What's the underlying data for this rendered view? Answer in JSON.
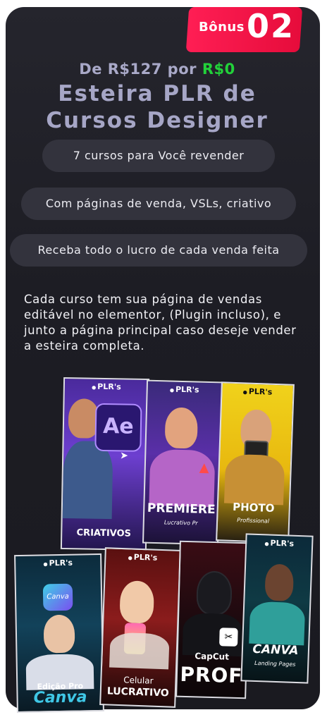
{
  "badge": {
    "label": "Bônus",
    "number": "02"
  },
  "price": {
    "from": "De R$127 por",
    "to": "R$0"
  },
  "title": {
    "line1": "Esteira PLR de",
    "line2": "Cursos Designer"
  },
  "pills": [
    "7 cursos para Você revender",
    "Com páginas de venda, VSLs, criativo",
    "Receba todo o lucro de cada venda feita"
  ],
  "description": "Cada curso tem sua página de vendas editável no elementor, (Plugin incluso), e junto a página principal caso deseje vender a esteira completa.",
  "covers": {
    "logo": "PLR's",
    "ae": {
      "icon": "Ae",
      "title": "CRIATIVOS"
    },
    "premiere": {
      "title": "PREMIERE",
      "sub": "Lucrativo Pr"
    },
    "photo": {
      "title": "PHOTO",
      "sub": "Profissional"
    },
    "canva_pro": {
      "icon": "Canva",
      "title": "Edição Pro",
      "brand": "Canva"
    },
    "celular": {
      "title": "Celular",
      "sub": "LUCRATIVO"
    },
    "capcut": {
      "brand": "CapCut",
      "title": "PROF"
    },
    "canva_lp": {
      "brand": "CANVA",
      "sub": "Landing Pages"
    }
  },
  "colors": {
    "accent_red": "#ff1e54",
    "green": "#22d13a",
    "title": "#a6a6c6"
  }
}
